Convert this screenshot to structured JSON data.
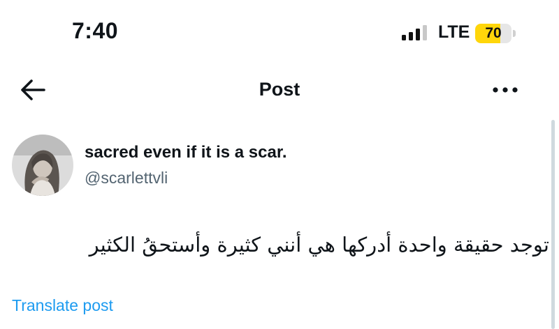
{
  "status_bar": {
    "time": "7:40",
    "network": "LTE",
    "battery_level": "70",
    "battery_fraction": 0.7,
    "battery_color": "#ffd60a"
  },
  "nav": {
    "title": "Post",
    "back_icon": "arrow-left-icon",
    "more_icon": "more-horizontal-icon"
  },
  "post": {
    "display_name": "sacred even if it is a scar.",
    "handle": "@scarlettvli",
    "text": "توجد حقيقة واحدة أدركها هي أنني كثيرة وأستحقُ الكثير",
    "translate_label": "Translate post"
  },
  "colors": {
    "link": "#1d9bf0",
    "secondary_text": "#536471",
    "primary_text": "#0f1419"
  }
}
